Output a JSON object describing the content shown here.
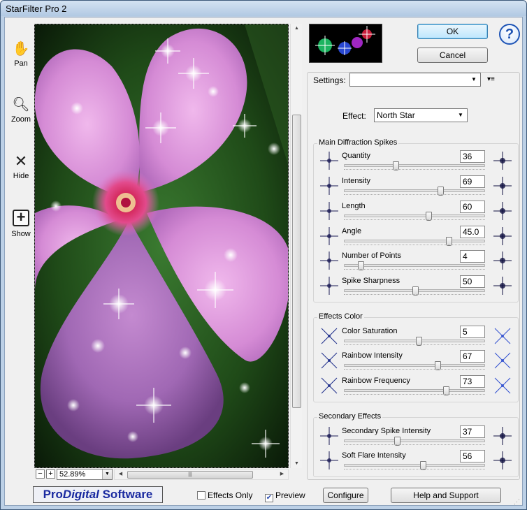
{
  "window": {
    "title": "StarFilter Pro 2"
  },
  "tools": [
    {
      "label": "Pan",
      "icon": "hand-icon"
    },
    {
      "label": "Zoom",
      "icon": "magnifier-icon"
    },
    {
      "label": "Hide",
      "icon": "x-icon"
    },
    {
      "label": "Show",
      "icon": "plus-box-icon"
    }
  ],
  "zoom": {
    "value": "52.89%"
  },
  "buttons": {
    "ok": "OK",
    "cancel": "Cancel",
    "help": "?",
    "configure": "Configure",
    "help_support": "Help and Support"
  },
  "settings": {
    "label": "Settings:",
    "value": ""
  },
  "effect": {
    "label": "Effect:",
    "value": "North Star"
  },
  "groups": {
    "main": {
      "title": "Main Diffraction Spikes",
      "params": [
        {
          "label": "Quantity",
          "value": "36",
          "pos": 0.36
        },
        {
          "label": "Intensity",
          "value": "69",
          "pos": 0.69
        },
        {
          "label": "Length",
          "value": "60",
          "pos": 0.6
        },
        {
          "label": "Angle",
          "value": "45.0",
          "pos": 0.75
        },
        {
          "label": "Number of Points",
          "value": "4",
          "pos": 0.1
        },
        {
          "label": "Spike Sharpness",
          "value": "50",
          "pos": 0.5
        }
      ]
    },
    "color": {
      "title": "Effects Color",
      "params": [
        {
          "label": "Color Saturation",
          "value": "5",
          "pos": 0.53
        },
        {
          "label": "Rainbow Intensity",
          "value": "67",
          "pos": 0.67
        },
        {
          "label": "Rainbow Frequency",
          "value": "73",
          "pos": 0.73
        }
      ]
    },
    "secondary": {
      "title": "Secondary Effects",
      "params": [
        {
          "label": "Secondary Spike Intensity",
          "value": "37",
          "pos": 0.37
        },
        {
          "label": "Soft Flare Intensity",
          "value": "56",
          "pos": 0.56
        }
      ]
    }
  },
  "footer": {
    "brand_pre": "Pro",
    "brand_mid": "Digital",
    "brand_post": " Software",
    "effects_only": {
      "label": "Effects Only",
      "checked": false
    },
    "preview": {
      "label": "Preview",
      "checked": true
    }
  },
  "colors": {
    "accent": "#1a2aa0",
    "petal": "#d88ad8",
    "center": "#c0185a",
    "leaf": "#2e6a24"
  }
}
